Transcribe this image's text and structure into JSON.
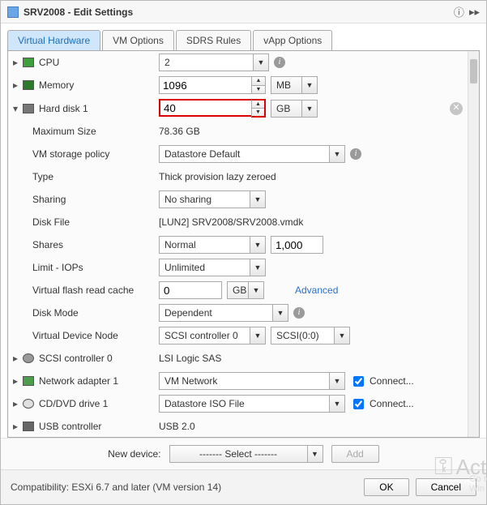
{
  "window": {
    "title": "SRV2008 - Edit Settings"
  },
  "tabs": {
    "virtual_hardware": "Virtual Hardware",
    "vm_options": "VM Options",
    "sdrs_rules": "SDRS Rules",
    "vapp_options": "vApp Options"
  },
  "devices": {
    "cpu": {
      "label": "CPU",
      "value": "2"
    },
    "memory": {
      "label": "Memory",
      "value": "1096",
      "unit": "MB"
    },
    "hard_disk_1": {
      "label": "Hard disk 1",
      "value": "40",
      "unit": "GB",
      "max_size_label": "Maximum Size",
      "max_size": "78.36 GB",
      "storage_policy_label": "VM storage policy",
      "storage_policy": "Datastore Default",
      "type_label": "Type",
      "type": "Thick provision lazy zeroed",
      "sharing_label": "Sharing",
      "sharing": "No sharing",
      "disk_file_label": "Disk File",
      "disk_file": "[LUN2] SRV2008/SRV2008.vmdk",
      "shares_label": "Shares",
      "shares_level": "Normal",
      "shares_value": "1,000",
      "limit_label": "Limit - IOPs",
      "limit": "Unlimited",
      "flash_label": "Virtual flash read cache",
      "flash_value": "0",
      "flash_unit": "GB",
      "advanced_label": "Advanced",
      "disk_mode_label": "Disk Mode",
      "disk_mode": "Dependent",
      "node_label": "Virtual Device Node",
      "node_controller": "SCSI controller 0",
      "node_slot": "SCSI(0:0)"
    },
    "scsi0": {
      "label": "SCSI controller 0",
      "value": "LSI Logic SAS"
    },
    "net1": {
      "label": "Network adapter 1",
      "value": "VM Network",
      "connect": "Connect..."
    },
    "cd1": {
      "label": "CD/DVD drive 1",
      "value": "Datastore ISO File",
      "connect": "Connect..."
    },
    "usb": {
      "label": "USB controller",
      "value": "USB 2.0"
    }
  },
  "new_device": {
    "label": "New device:",
    "select": "------- Select -------",
    "add": "Add"
  },
  "footer": {
    "compat": "Compatibility: ESXi 6.7 and later (VM version 14)",
    "ok": "OK",
    "cancel": "Cancel"
  }
}
